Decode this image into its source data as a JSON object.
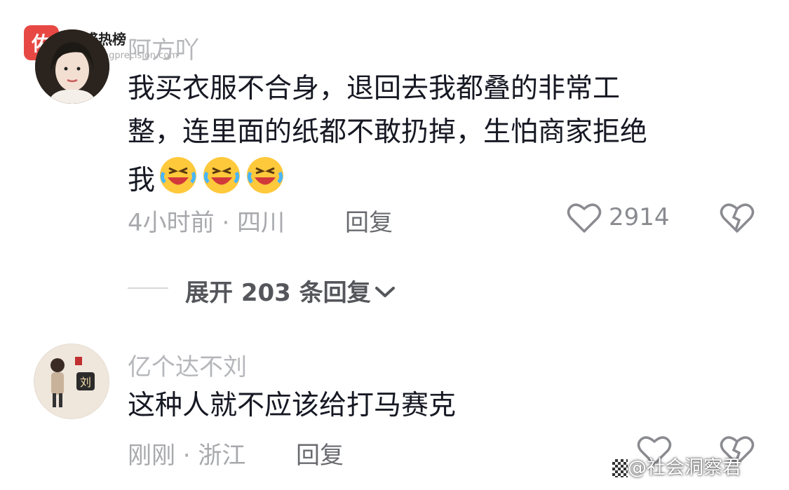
{
  "watermark": {
    "badge": "佑",
    "title": "佑盛热榜",
    "url": "youshengprecision.com"
  },
  "comments": [
    {
      "username": "阿方吖",
      "text_lines": [
        "我买衣服不合身，退回去我都叠的非常工",
        "整，连里面的纸都不敢扔掉，生怕商家拒绝",
        "我"
      ],
      "emoji": "laugh-cry-emoji",
      "meta": "4小时前 · 四川",
      "reply_label": "回复",
      "like_count": "2914"
    },
    {
      "username": "亿个达不刘",
      "avatar_text": "刘",
      "text": "这种人就不应该给打马赛克",
      "meta": "刚刚 · 浙江",
      "reply_label": "回复"
    }
  ],
  "expand": {
    "label": "展开 203 条回复"
  },
  "bottom_watermark": "@社会洞察君",
  "colors": {
    "text": "#161823",
    "secondary": "#a8a9ad",
    "accent": "#e53935"
  }
}
